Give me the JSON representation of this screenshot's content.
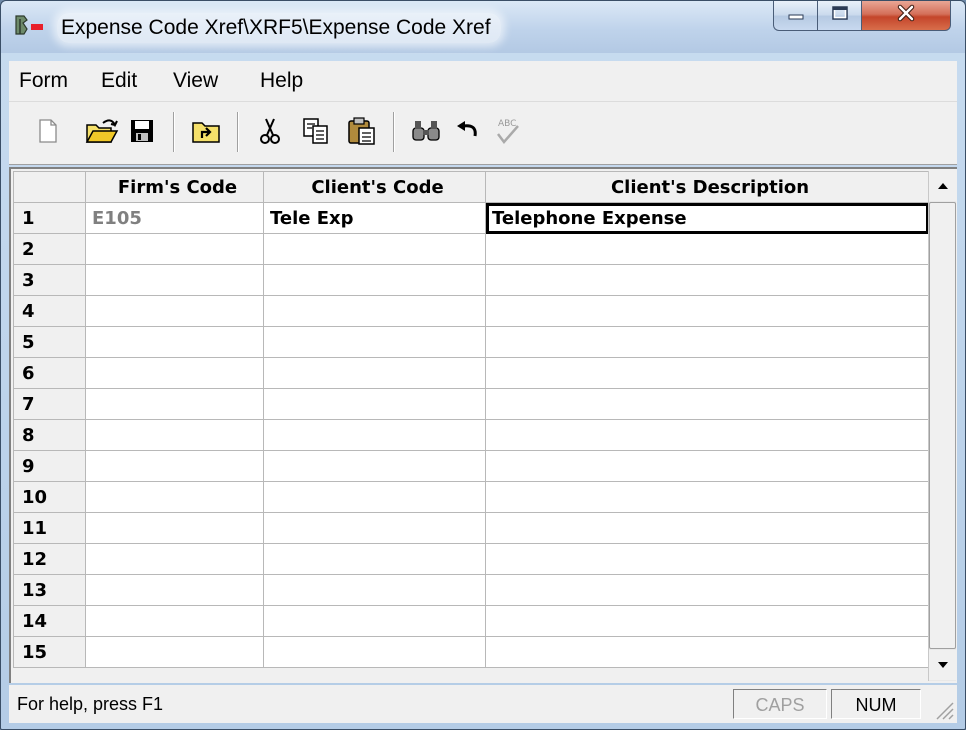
{
  "window": {
    "title": "Expense Code Xref\\XRF5\\Expense Code Xref",
    "icons": {
      "app": "app-logo-icon",
      "minimize": "minimize-icon",
      "maximize": "maximize-icon",
      "close": "close-icon"
    }
  },
  "menu": {
    "items": [
      "Form",
      "Edit",
      "View",
      "Help"
    ]
  },
  "toolbar": {
    "buttons": [
      "new-document-icon",
      "open-folder-icon",
      "save-disk-icon",
      "import-icon",
      "cut-icon",
      "copy-icon",
      "paste-icon",
      "find-icon",
      "undo-icon",
      "spell-check-icon"
    ]
  },
  "grid": {
    "columns": [
      "",
      "Firm's Code",
      "Client's Code",
      "Client's Description"
    ],
    "rows": [
      {
        "num": "1",
        "firm_code": "E105",
        "client_code": "Tele Exp",
        "client_description": "Telephone Expense"
      },
      {
        "num": "2",
        "firm_code": "",
        "client_code": "",
        "client_description": ""
      },
      {
        "num": "3",
        "firm_code": "",
        "client_code": "",
        "client_description": ""
      },
      {
        "num": "4",
        "firm_code": "",
        "client_code": "",
        "client_description": ""
      },
      {
        "num": "5",
        "firm_code": "",
        "client_code": "",
        "client_description": ""
      },
      {
        "num": "6",
        "firm_code": "",
        "client_code": "",
        "client_description": ""
      },
      {
        "num": "7",
        "firm_code": "",
        "client_code": "",
        "client_description": ""
      },
      {
        "num": "8",
        "firm_code": "",
        "client_code": "",
        "client_description": ""
      },
      {
        "num": "9",
        "firm_code": "",
        "client_code": "",
        "client_description": ""
      },
      {
        "num": "10",
        "firm_code": "",
        "client_code": "",
        "client_description": ""
      },
      {
        "num": "11",
        "firm_code": "",
        "client_code": "",
        "client_description": ""
      },
      {
        "num": "12",
        "firm_code": "",
        "client_code": "",
        "client_description": ""
      },
      {
        "num": "13",
        "firm_code": "",
        "client_code": "",
        "client_description": ""
      },
      {
        "num": "14",
        "firm_code": "",
        "client_code": "",
        "client_description": ""
      },
      {
        "num": "15",
        "firm_code": "",
        "client_code": "",
        "client_description": ""
      }
    ]
  },
  "statusbar": {
    "help_text": "For help, press F1",
    "caps": "CAPS",
    "num": "NUM"
  }
}
